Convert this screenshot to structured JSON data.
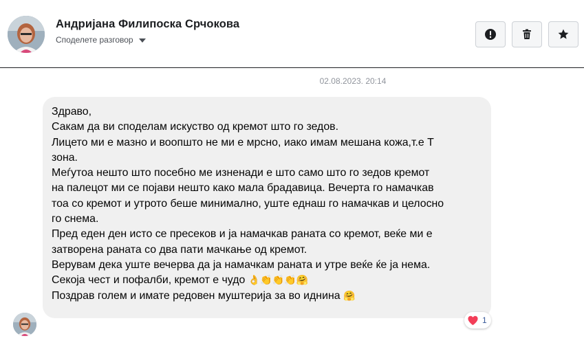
{
  "header": {
    "contact_name": "Андријана Филипоска Срчокова",
    "share_label": "Споделете разговор",
    "buttons": {
      "spam_icon": "exclamation-circle-icon",
      "delete_icon": "trash-icon",
      "star_icon": "star-icon"
    }
  },
  "conversation": {
    "timestamp": "02.08.2023. 20:14",
    "message": {
      "lines": [
        "Здраво,",
        "Сакам да ви споделам искуство од кремот што го зедов.",
        "Лицето ми е мазно и воопшто не ми е мрсно, иако имам мешана кожа,т.е Т",
        "зона.",
        "Меѓутоа нешто што посебно ме изненади е што само што го зедов кремот",
        "на палецот ми се појави нешто како мала брадавица. Вечерта го намачкав",
        "тоа со кремот и утрото беше минимално, уште еднаш го намачкав и целосно",
        "го снема.",
        "Пред еден ден исто се пресеков и ја намачкав раната со кремот, веќе ми е",
        "затворена раната со два пати мачкање од кремот.",
        "Верувам дека уште вечерва да ја намачкам раната и утре веќе ќе ја нема.",
        "Секоја чест и пофалби, кремот е чудо ",
        "Поздрав голем и имате редовен муштерија за во иднина "
      ],
      "emoji_line_12": "👌👏👏👏🤗",
      "emoji_line_13": "🤗"
    },
    "reaction": {
      "icon": "heart-icon",
      "count": "1",
      "color": "#f33e58"
    }
  },
  "colors": {
    "bubble": "#f0f0f0",
    "timestamp": "#90949c",
    "button_border": "#ccd0d5"
  }
}
